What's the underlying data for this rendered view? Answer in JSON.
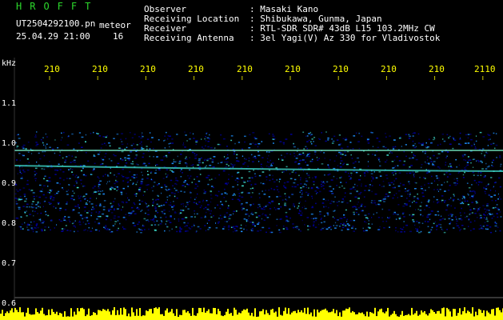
{
  "header": {
    "app_title": "HROFFT",
    "file_name": "UT2504292100.pn",
    "meteor_label": "meteor",
    "timestamp": "25.04.29 21:00",
    "count": "16",
    "info": [
      {
        "label": "Observer",
        "value": ": Masaki Kano"
      },
      {
        "label": "Receiving Location",
        "value": ": Shibukawa, Gunma, Japan"
      },
      {
        "label": "Receiver",
        "value": ": RTL-SDR SDR# 43dB L15 103.2MHz CW"
      },
      {
        "label": "Receiving Antenna",
        "value": ": 3el Yagi(V) Az 330 for Vladivostok"
      }
    ]
  },
  "plot": {
    "y_unit": "kHz",
    "y_ticks": [
      "1.1",
      "1.0",
      "0.9",
      "0.8",
      "0.7",
      "0.6"
    ],
    "x_ticks": [
      "210",
      "210",
      "210",
      "210",
      "210",
      "210",
      "210",
      "210",
      "210",
      "2110"
    ],
    "colors": {
      "background": "#000000",
      "axis_text": "#ffffff",
      "tick_text": "#ffff00",
      "tick_mark": "#c8c800",
      "noise_base": "#0000a0",
      "noise_bright": "#1e90ff",
      "noise_peak": "#40e0d0",
      "signal_line": "#7fffd4",
      "echo_count_bars": "#ffff00",
      "baseline_rule": "#9a9a9a"
    }
  }
}
